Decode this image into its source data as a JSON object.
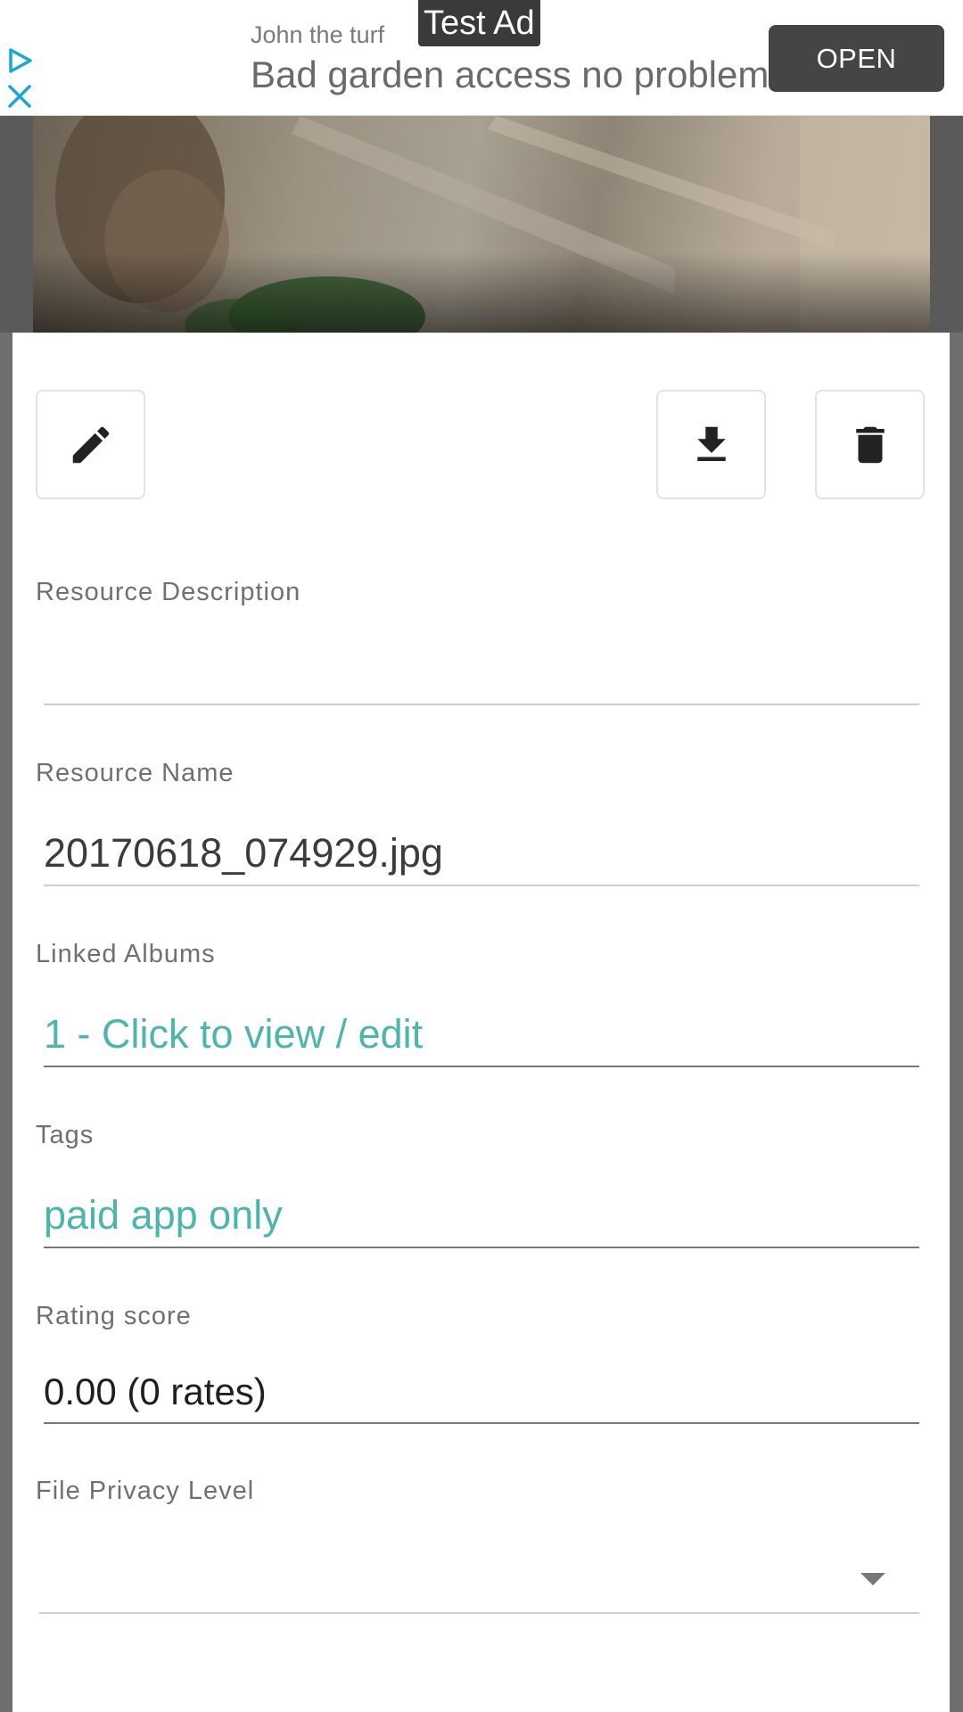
{
  "ad": {
    "advertiser": "John the turf",
    "badge": "Test Ad",
    "headline": "Bad garden access no problem",
    "open_label": "OPEN",
    "play_icon": "ad-choices-play-icon",
    "close_icon": "close-icon",
    "accent_color": "#1aa7d4"
  },
  "photo": {
    "alt_icon": "image-preview"
  },
  "actions": {
    "edit_icon": "pencil-icon",
    "download_icon": "download-icon",
    "delete_icon": "trash-icon"
  },
  "fields": {
    "description": {
      "label": "Resource Description",
      "value": ""
    },
    "name": {
      "label": "Resource Name",
      "value": "20170618_074929.jpg"
    },
    "albums": {
      "label": "Linked Albums",
      "value": "1 - Click to view / edit"
    },
    "tags": {
      "label": "Tags",
      "value": "paid app only"
    },
    "rating": {
      "label": "Rating score",
      "value": "0.00 (0 rates)"
    },
    "privacy": {
      "label": "File Privacy Level",
      "value": ""
    }
  },
  "colors": {
    "accent_teal": "#4db6ac",
    "ad_button": "#454545"
  }
}
